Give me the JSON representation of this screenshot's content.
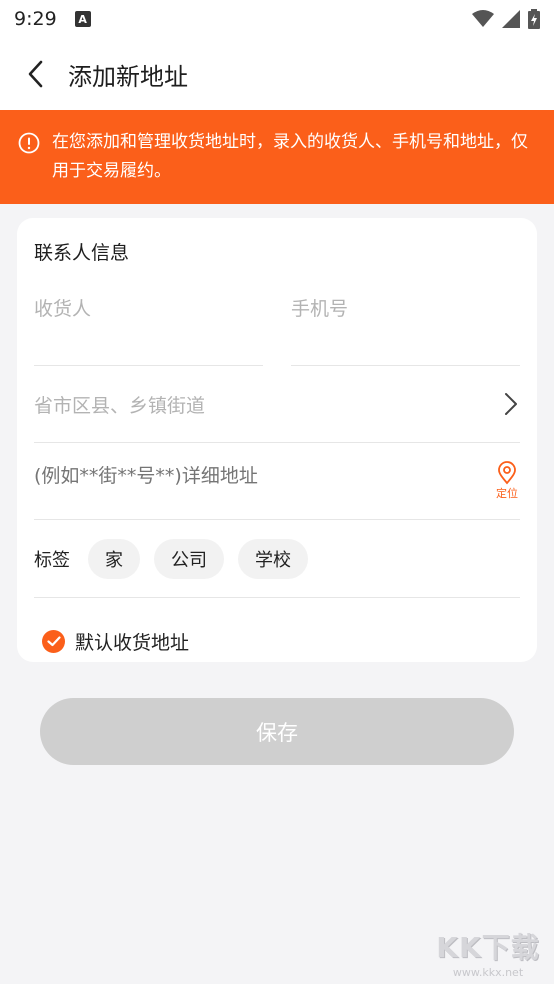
{
  "status_bar": {
    "time": "9:29",
    "notification_icon_letter": "A"
  },
  "app_bar": {
    "title": "添加新地址"
  },
  "notice": {
    "text": "在您添加和管理收货地址时，录入的收货人、手机号和地址，仅用于交易履约。"
  },
  "form": {
    "section_title": "联系人信息",
    "receiver_placeholder": "收货人",
    "phone_placeholder": "手机号",
    "region_placeholder": "省市区县、乡镇街道",
    "detail_placeholder": "(例如**街**号**)详细地址",
    "locate_label": "定位",
    "tag_label": "标签",
    "tags": [
      "家",
      "公司",
      "学校"
    ],
    "default_label": "默认收货地址",
    "default_checked": true
  },
  "save_label": "保存",
  "watermark": {
    "main": "KK下载",
    "sub": "www.kkx.net"
  },
  "colors": {
    "accent": "#fb5f1a",
    "background": "#f4f4f6",
    "save_disabled": "#cfcfcf"
  }
}
